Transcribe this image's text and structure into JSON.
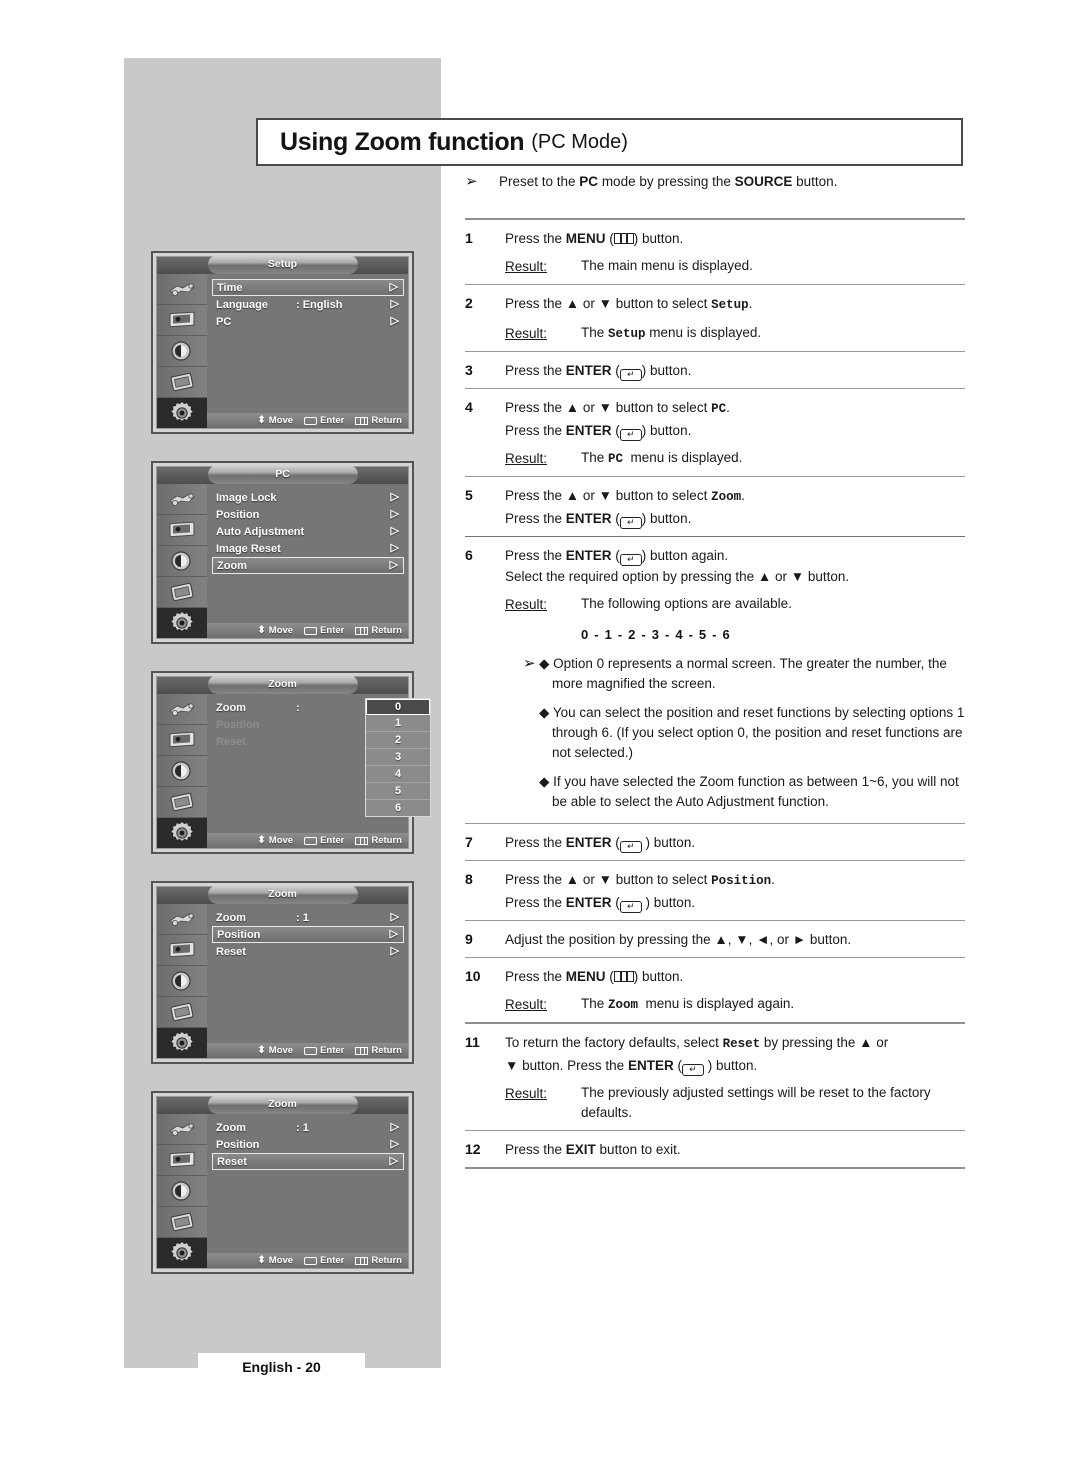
{
  "page": {
    "title_main": "Using Zoom function",
    "title_sub": "(PC Mode)",
    "footer": "English - 20"
  },
  "preset": {
    "arrow": "➢",
    "text_a": "Preset to the ",
    "bold_a": "PC",
    "text_b": " mode by pressing the ",
    "bold_b": "SOURCE",
    "text_c": " button."
  },
  "steps": [
    {
      "num": "1",
      "lines": [
        "Press the MENU ( ) button."
      ],
      "result_label": "Result:",
      "result_text": "The main menu is displayed."
    },
    {
      "num": "2",
      "lines": [
        "Press the ▲ or ▼ button to select Setup."
      ],
      "result_label": "Result:",
      "result_text": "The Setup menu is displayed."
    },
    {
      "num": "3",
      "lines": [
        "Press the ENTER ( ) button."
      ]
    },
    {
      "num": "4",
      "lines": [
        "Press the ▲ or ▼ button to select PC.",
        "Press the ENTER ( ) button."
      ],
      "result_label": "Result:",
      "result_text": "The PC  menu is displayed."
    },
    {
      "num": "5",
      "lines": [
        "Press the ▲ or ▼ button to select Zoom.",
        "Press the ENTER ( ) button."
      ]
    },
    {
      "num": "6",
      "lines": [
        "Press the ENTER ( ) button again.",
        "Select the required option by pressing the ▲ or ▼ button."
      ],
      "result_label": "Result:",
      "result_text": "The following options are available.",
      "options_line": "0 - 1 - 2 - 3 - 4 - 5 - 6",
      "notes": [
        "◆ Option 0 represents a normal screen. The greater the number, the more magnified the screen.",
        "◆ You can select the position and reset functions by selecting options 1 through 6. (If you select option 0, the position and reset functions are not selected.)",
        "◆ If you have selected the Zoom function as between 1~6, you will not be able to select the Auto Adjustment function."
      ]
    },
    {
      "num": "7",
      "lines": [
        "Press the ENTER ( ) button."
      ]
    },
    {
      "num": "8",
      "lines": [
        "Press the ▲ or ▼ button to select Position.",
        "Press the ENTER ( ) button."
      ]
    },
    {
      "num": "9",
      "lines": [
        "Adjust the position by pressing the ▲, ▼, ◄, or ► button."
      ]
    },
    {
      "num": "10",
      "lines": [
        "Press the MENU ( ) button."
      ],
      "result_label": "Result:",
      "result_text": "The Zoom  menu is displayed again."
    },
    {
      "num": "11",
      "lines": [
        "To return the factory defaults, select Reset by pressing the ▲ or",
        "▼ button. Press the ENTER ( ) button."
      ],
      "result_label": "Result:",
      "result_text": "The previously adjusted settings will be reset to the factory defaults."
    },
    {
      "num": "12",
      "lines": [
        "Press the EXIT button to exit."
      ]
    }
  ],
  "osd_common": {
    "footer": {
      "move": "Move",
      "enter": "Enter",
      "return": "Return"
    },
    "sidebar_icons": [
      "input-source-icon",
      "picture-icon",
      "sound-icon",
      "channel-icon",
      "setup-gear-icon"
    ],
    "arrow_glyph": "▷"
  },
  "osd_screens": [
    {
      "id": "setup-menu",
      "title": "Setup",
      "rows": [
        {
          "label": "Time",
          "value": "",
          "selected": true,
          "dim": false,
          "arrow": true
        },
        {
          "label": "Language",
          "value": ": English",
          "selected": false,
          "dim": false,
          "arrow": true
        },
        {
          "label": "PC",
          "value": "",
          "selected": false,
          "dim": false,
          "arrow": true
        }
      ]
    },
    {
      "id": "pc-menu",
      "title": "PC",
      "rows": [
        {
          "label": "Image Lock",
          "value": "",
          "selected": false,
          "dim": false,
          "arrow": true
        },
        {
          "label": "Position",
          "value": "",
          "selected": false,
          "dim": false,
          "arrow": true
        },
        {
          "label": "Auto Adjustment",
          "value": "",
          "selected": false,
          "dim": false,
          "arrow": true
        },
        {
          "label": "Image Reset",
          "value": "",
          "selected": false,
          "dim": false,
          "arrow": true
        },
        {
          "label": "Zoom",
          "value": "",
          "selected": true,
          "dim": false,
          "arrow": true
        }
      ]
    },
    {
      "id": "zoom-menu-options",
      "title": "Zoom",
      "rows": [
        {
          "label": "Zoom",
          "value": ":",
          "selected": false,
          "dim": false,
          "arrow": false
        },
        {
          "label": "Position",
          "value": "",
          "selected": false,
          "dim": true,
          "arrow": false
        },
        {
          "label": "Reset",
          "value": "",
          "selected": false,
          "dim": true,
          "arrow": false
        }
      ],
      "dropdown": {
        "options": [
          "0",
          "1",
          "2",
          "3",
          "4",
          "5",
          "6"
        ],
        "selected_index": 0
      }
    },
    {
      "id": "zoom-menu-position",
      "title": "Zoom",
      "rows": [
        {
          "label": "Zoom",
          "value": ": 1",
          "selected": false,
          "dim": false,
          "arrow": true
        },
        {
          "label": "Position",
          "value": "",
          "selected": true,
          "dim": false,
          "arrow": true
        },
        {
          "label": "Reset",
          "value": "",
          "selected": false,
          "dim": false,
          "arrow": true
        }
      ]
    },
    {
      "id": "zoom-menu-reset",
      "title": "Zoom",
      "rows": [
        {
          "label": "Zoom",
          "value": ": 1",
          "selected": false,
          "dim": false,
          "arrow": true
        },
        {
          "label": "Position",
          "value": "",
          "selected": false,
          "dim": false,
          "arrow": true
        },
        {
          "label": "Reset",
          "value": "",
          "selected": true,
          "dim": false,
          "arrow": true
        }
      ]
    }
  ]
}
